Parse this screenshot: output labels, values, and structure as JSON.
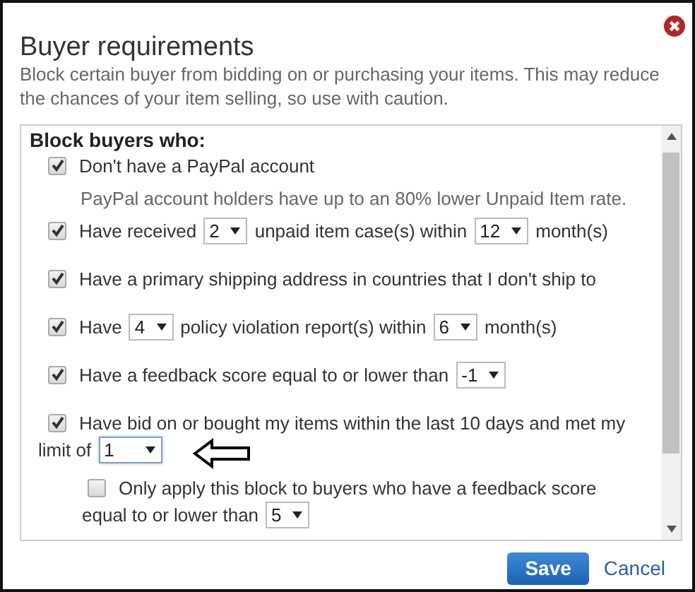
{
  "dialog": {
    "title": "Buyer requirements",
    "description": "Block certain buyer from bidding on or purchasing your items. This may reduce the chances of your item selling, so use with caution."
  },
  "section": {
    "heading": "Block buyers who:",
    "rules": [
      {
        "checked": true,
        "lines": [
          [
            {
              "kind": "text",
              "text": "Don't have a PayPal account"
            }
          ]
        ],
        "note": "PayPal account holders have up to an 80% lower Unpaid Item rate."
      },
      {
        "checked": true,
        "lines": [
          [
            {
              "kind": "text",
              "text": "Have received"
            },
            {
              "kind": "select",
              "value": "2",
              "focused": false
            },
            {
              "kind": "text",
              "text": "unpaid item case(s) within"
            },
            {
              "kind": "select",
              "value": "12",
              "focused": false
            },
            {
              "kind": "text",
              "text": "month(s)"
            }
          ]
        ]
      },
      {
        "checked": true,
        "lines": [
          [
            {
              "kind": "text",
              "text": "Have a primary shipping address in countries that I don't ship to"
            }
          ]
        ]
      },
      {
        "checked": true,
        "lines": [
          [
            {
              "kind": "text",
              "text": "Have"
            },
            {
              "kind": "select",
              "value": "4",
              "focused": false
            },
            {
              "kind": "text",
              "text": "policy violation report(s) within"
            },
            {
              "kind": "select",
              "value": "6",
              "focused": false
            },
            {
              "kind": "text",
              "text": "month(s)"
            }
          ]
        ]
      },
      {
        "checked": true,
        "lines": [
          [
            {
              "kind": "text",
              "text": "Have a feedback score equal to or lower than"
            },
            {
              "kind": "select",
              "value": "-1",
              "focused": false
            }
          ]
        ]
      },
      {
        "checked": true,
        "lines": [
          [
            {
              "kind": "text",
              "text": "Have bid on or bought my items within the last 10 days and met my"
            }
          ],
          [
            {
              "kind": "text",
              "text": "limit of"
            },
            {
              "kind": "select",
              "value": "1",
              "focused": true
            }
          ]
        ],
        "pointer_arrow": true,
        "children": [
          {
            "checked": false,
            "lines": [
              [
                {
                  "kind": "text",
                  "text": "Only apply this block to buyers who have a feedback score"
                }
              ],
              [
                {
                  "kind": "text",
                  "text": "equal to or lower than"
                },
                {
                  "kind": "select",
                  "value": "5",
                  "focused": false
                }
              ]
            ]
          }
        ]
      }
    ]
  },
  "buttons": [
    {
      "label": "Save",
      "kind": "primary"
    },
    {
      "label": "Cancel",
      "kind": "link"
    }
  ]
}
